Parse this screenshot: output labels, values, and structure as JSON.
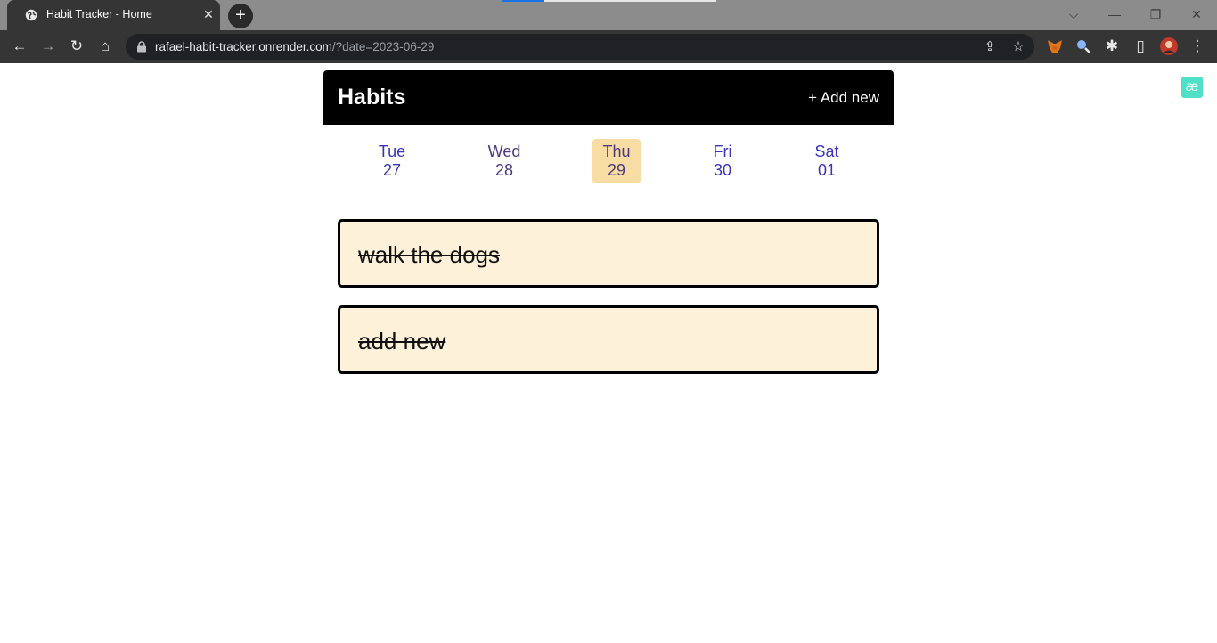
{
  "browser": {
    "tab": {
      "title": "Habit Tracker - Home",
      "close_glyph": "✕",
      "icon": "globe-icon"
    },
    "new_tab_glyph": "+",
    "window_controls": {
      "dropdown": "⌵",
      "minimize": "—",
      "restore": "❐",
      "close": "✕"
    },
    "nav": {
      "back": "←",
      "forward": "→",
      "reload": "↻",
      "home": "⌂"
    },
    "url": {
      "host": "rafael-habit-tracker.onrender.com",
      "rest": "/?date=2023-06-29"
    },
    "omnibox_icons": {
      "share": "⇪",
      "bookmark": "☆"
    },
    "toolbar_icons": {
      "extensions": "✱",
      "side_panel": "▯",
      "menu": "⋮"
    }
  },
  "app": {
    "title": "Habits",
    "add_new_label": "+ Add new",
    "days": [
      {
        "weekday": "Tue",
        "date": "27",
        "selected": false
      },
      {
        "weekday": "Wed",
        "date": "28",
        "selected": false
      },
      {
        "weekday": "Thu",
        "date": "29",
        "selected": true
      },
      {
        "weekday": "Fri",
        "date": "30",
        "selected": false
      },
      {
        "weekday": "Sat",
        "date": "01",
        "selected": false
      }
    ],
    "habits": [
      {
        "name": "walk the dogs",
        "completed": true
      },
      {
        "name": "add new",
        "completed": true
      }
    ]
  },
  "extension_badge": {
    "glyph": "æ",
    "color": "#4fe0c8"
  },
  "colors": {
    "day_text": "#3a34b8",
    "selected_day_bg": "#f7dca3",
    "habit_card_bg": "#fdf1d9",
    "header_bg": "#000000"
  }
}
